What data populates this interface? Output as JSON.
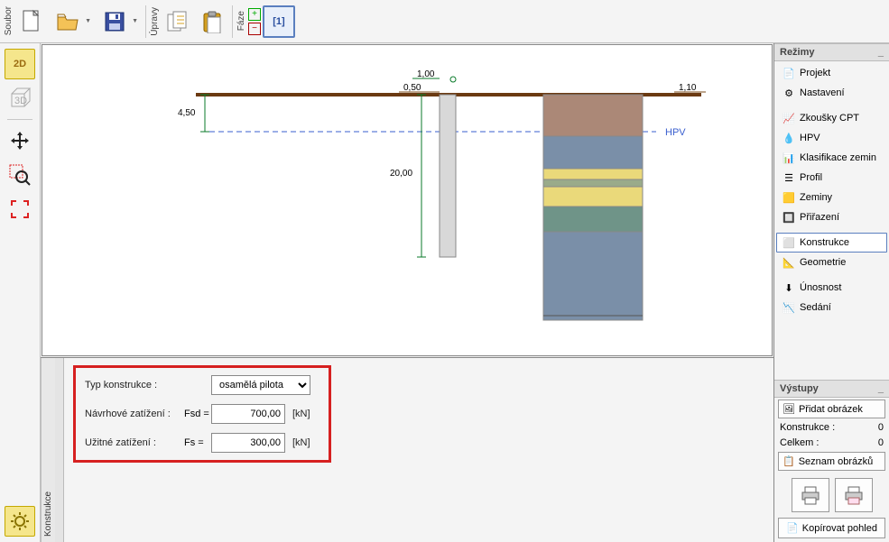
{
  "toolbar": {
    "soubor": "Soubor",
    "upravy": "Úpravy",
    "faze": "Fáze",
    "phase_label": "[1]"
  },
  "left": {
    "btn2d": "2D",
    "btn3d": "3D"
  },
  "drawing": {
    "top_dim": "1,00",
    "mid_dim": "0,50",
    "right_dim": "1,10",
    "left_dim": "4,50",
    "length_dim": "20,00",
    "hpv": "HPV"
  },
  "form": {
    "type_label": "Typ konstrukce :",
    "type_value": "osamělá pilota",
    "design_label": "Návrhové zatížení :",
    "design_sym": "Fsd =",
    "design_val": "700,00",
    "use_label": "Užitné zatížení :",
    "use_sym": "Fs  =",
    "use_val": "300,00",
    "unit": "[kN]",
    "tab": "Konstrukce"
  },
  "right": {
    "modes_title": "Režimy",
    "items": [
      {
        "label": "Projekt"
      },
      {
        "label": "Nastavení"
      },
      {
        "label": "Zkoušky CPT"
      },
      {
        "label": "HPV"
      },
      {
        "label": "Klasifikace zemin"
      },
      {
        "label": "Profil"
      },
      {
        "label": "Zeminy"
      },
      {
        "label": "Přiřazení"
      },
      {
        "label": "Konstrukce"
      },
      {
        "label": "Geometrie"
      },
      {
        "label": "Únosnost"
      },
      {
        "label": "Sedání"
      }
    ],
    "outputs_title": "Výstupy",
    "add_pic": "Přidat obrázek",
    "konstrukce_row": "Konstrukce :",
    "konstrukce_n": "0",
    "celkem_row": "Celkem :",
    "celkem_n": "0",
    "list_pics": "Seznam obrázků",
    "copy_view": "Kopírovat pohled"
  }
}
